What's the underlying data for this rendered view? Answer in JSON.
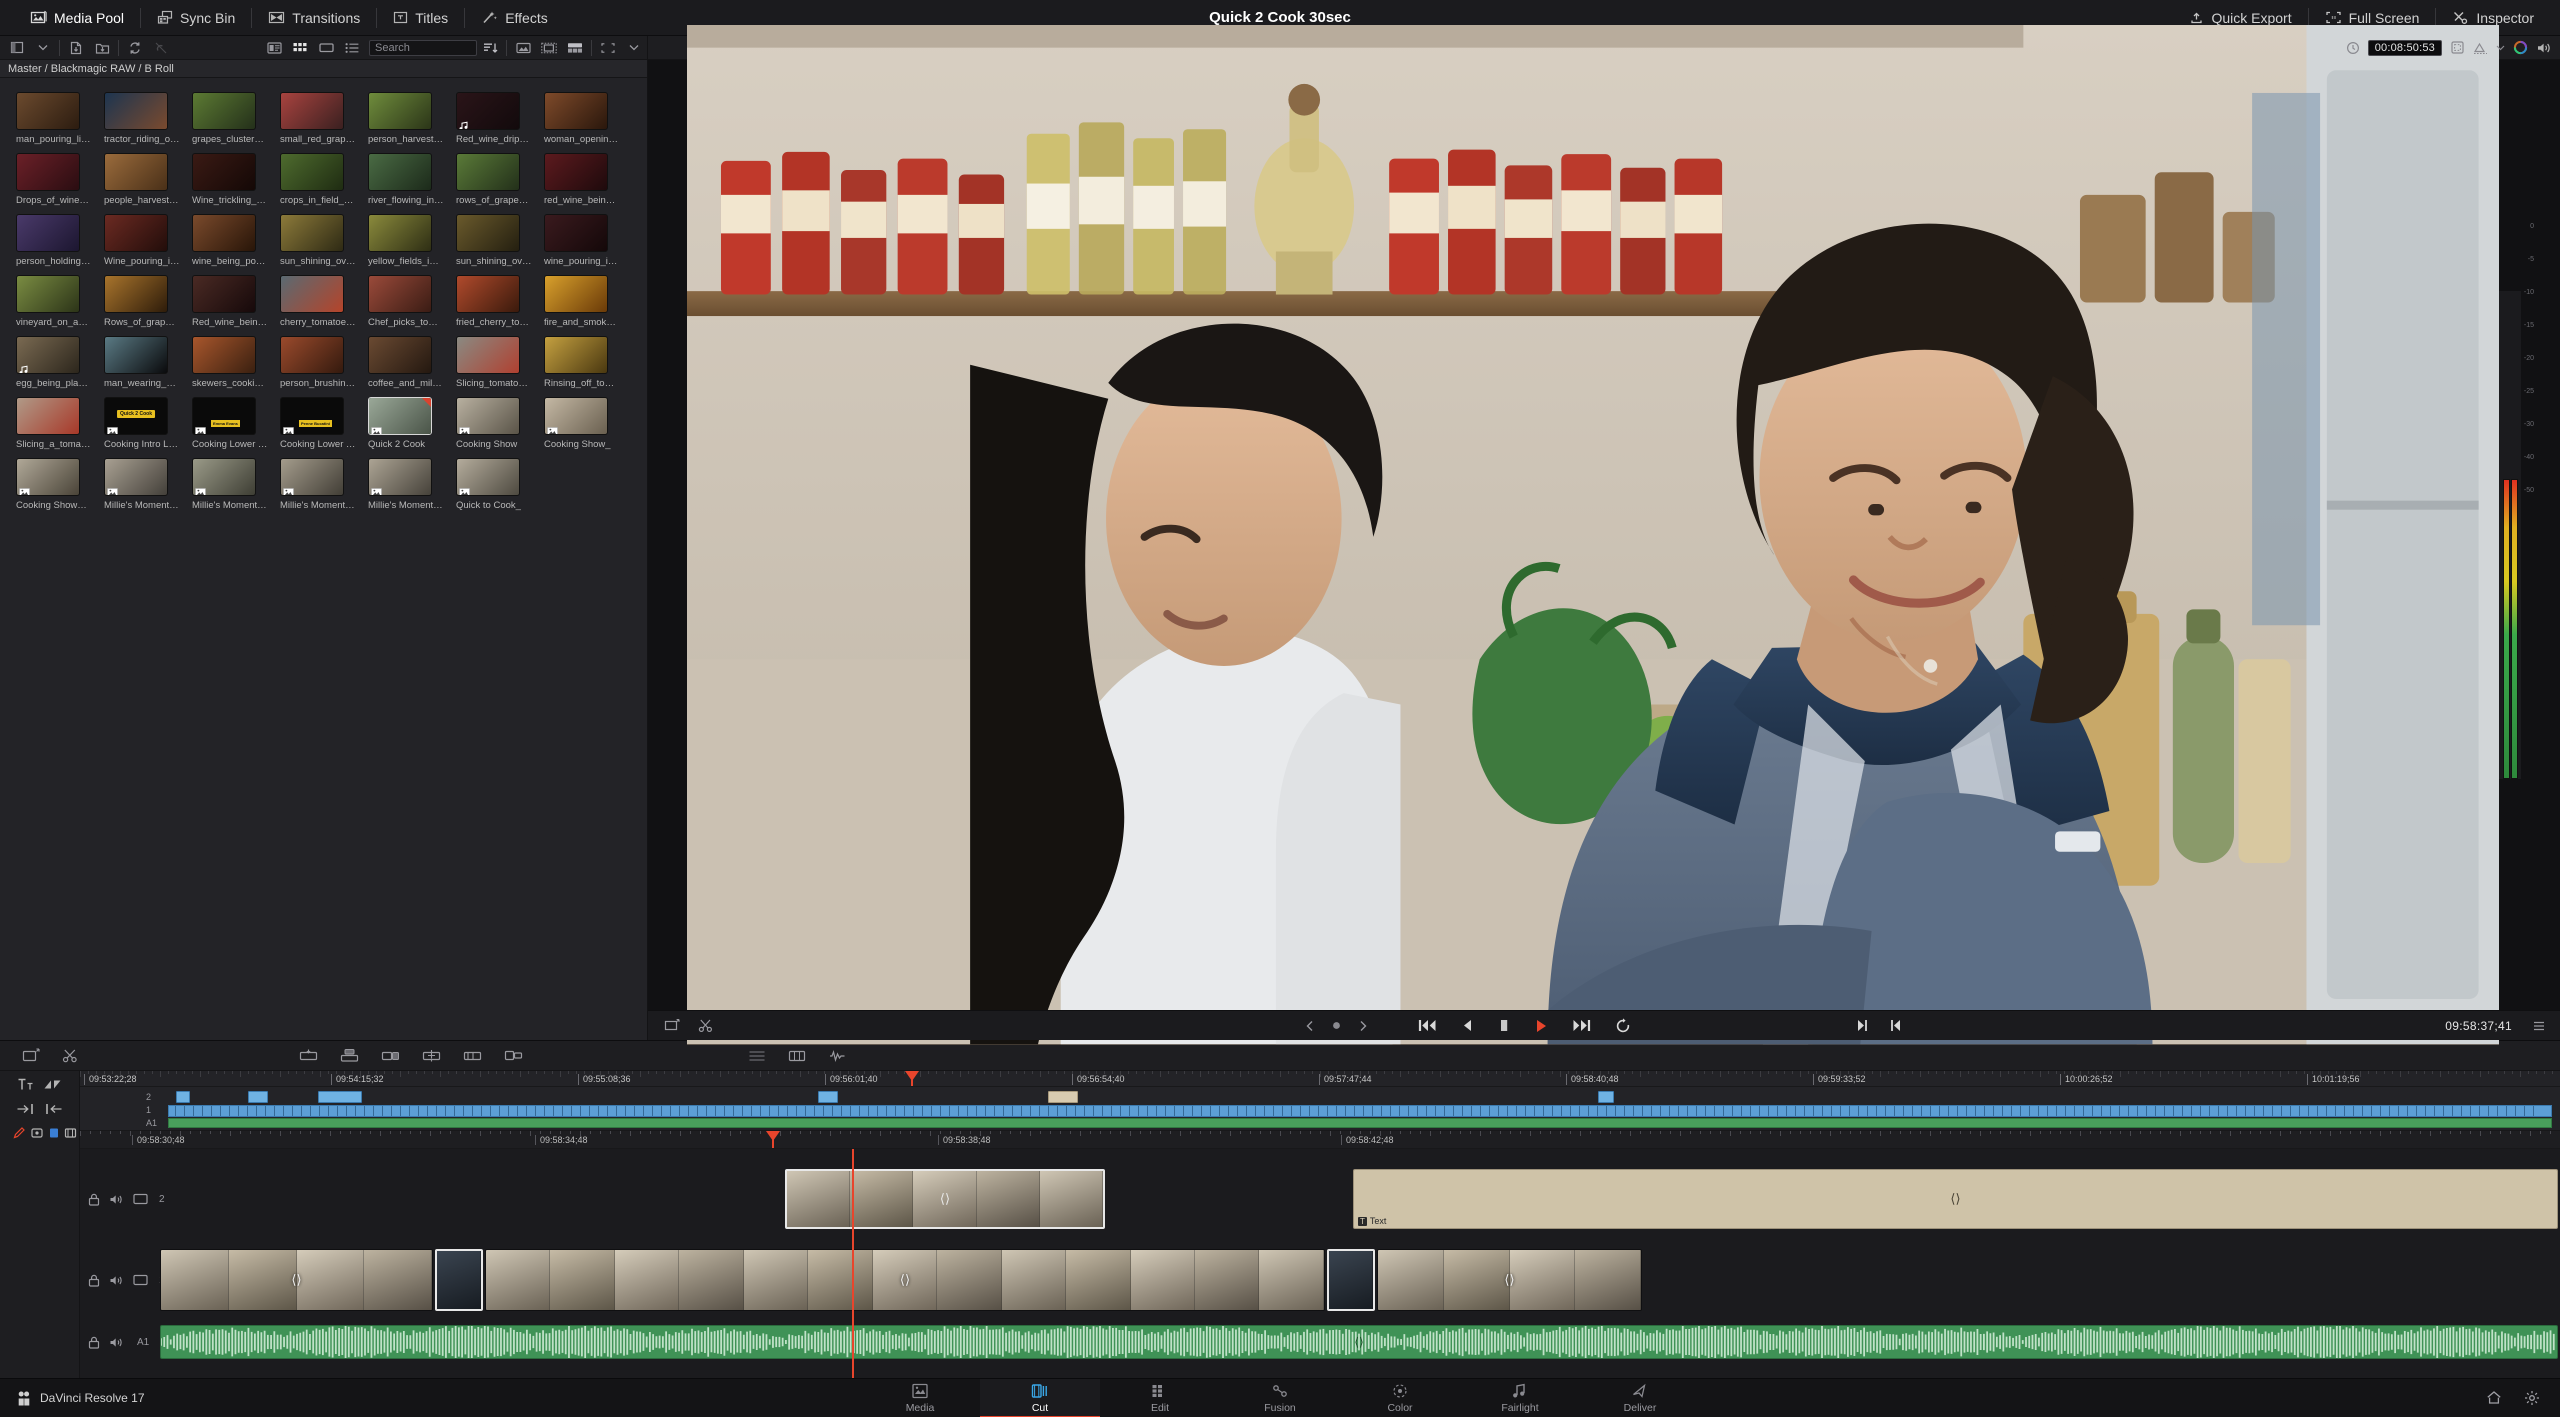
{
  "app": {
    "title": "Quick 2 Cook 30sec",
    "brand": "DaVinci Resolve 17"
  },
  "topbar": {
    "left_items": [
      {
        "label": "Media Pool",
        "icon": "media-pool-icon",
        "active": true
      },
      {
        "label": "Sync Bin",
        "icon": "sync-bin-icon",
        "active": false
      },
      {
        "label": "Transitions",
        "icon": "transitions-icon",
        "active": false
      },
      {
        "label": "Titles",
        "icon": "titles-icon",
        "active": false
      },
      {
        "label": "Effects",
        "icon": "effects-icon",
        "active": false
      }
    ],
    "right_items": [
      {
        "label": "Quick Export",
        "icon": "quick-export-icon"
      },
      {
        "label": "Full Screen",
        "icon": "full-screen-icon"
      },
      {
        "label": "Inspector",
        "icon": "inspector-icon"
      }
    ]
  },
  "mediapool": {
    "breadcrumb": "Master / Blackmagic RAW / B Roll",
    "search": {
      "placeholder": "Search",
      "value": ""
    },
    "toolbar_icons": [
      "sidebar-toggle-icon",
      "chevron-down-icon",
      "import-media-icon",
      "import-bin-icon",
      "sync-icon",
      "unlink-icon"
    ],
    "view_icons": [
      "metadata-view-icon",
      "thumbnail-view-icon",
      "filmstrip-view-icon",
      "list-view-icon",
      "sort-icon",
      "source-tape-icon",
      "full-clip-icon",
      "strip-view-icon",
      "fullscreen-icon",
      "chevron-down-icon"
    ],
    "clips": [
      {
        "label": "man_pouring_liqu...",
        "c1": "#6b4a2e",
        "c2": "#2c1c10",
        "badge": ""
      },
      {
        "label": "tractor_riding_ove...",
        "c1": "#1d3550",
        "c2": "#7a4a2e",
        "badge": ""
      },
      {
        "label": "grapes_cluster_on...",
        "c1": "#5c7a33",
        "c2": "#24301a",
        "badge": ""
      },
      {
        "label": "small_red_grape_c...",
        "c1": "#a8433f",
        "c2": "#3a2020",
        "badge": ""
      },
      {
        "label": "person_harvestin...",
        "c1": "#6f8c3c",
        "c2": "#2b3518",
        "badge": ""
      },
      {
        "label": "Red_wine_drippin...",
        "c1": "#2a1418",
        "c2": "#120a0c",
        "badge": "audio"
      },
      {
        "label": "woman_opening_...",
        "c1": "#7e4a2a",
        "c2": "#2a170c",
        "badge": ""
      },
      {
        "label": "Drops_of_wine_sp...",
        "c1": "#6b2028",
        "c2": "#2a0d11",
        "badge": ""
      },
      {
        "label": "people_harvesting...",
        "c1": "#9a6b3c",
        "c2": "#4a3018",
        "badge": ""
      },
      {
        "label": "Wine_trickling_fro...",
        "c1": "#3a1a14",
        "c2": "#140806",
        "badge": ""
      },
      {
        "label": "crops_in_field_at_...",
        "c1": "#4e6b2e",
        "c2": "#1f2c12",
        "badge": ""
      },
      {
        "label": "river_flowing_in_t...",
        "c1": "#4a6b44",
        "c2": "#1c2a1a",
        "badge": ""
      },
      {
        "label": "rows_of_grapevin...",
        "c1": "#5a7a38",
        "c2": "#23301a",
        "badge": ""
      },
      {
        "label": "red_wine_being_p...",
        "c1": "#5c1a1e",
        "c2": "#1e0a0c",
        "badge": ""
      },
      {
        "label": "person_holding_a...",
        "c1": "#4a3a6a",
        "c2": "#1c1630",
        "badge": ""
      },
      {
        "label": "Wine_pouring_int...",
        "c1": "#6b2a22",
        "c2": "#220d0a",
        "badge": ""
      },
      {
        "label": "wine_being_poure...",
        "c1": "#7a4a2c",
        "c2": "#281508",
        "badge": ""
      },
      {
        "label": "sun_shining_over_...",
        "c1": "#8c7a3a",
        "c2": "#2e2a14",
        "badge": ""
      },
      {
        "label": "yellow_fields_in_bl...",
        "c1": "#8a8a3c",
        "c2": "#2e2e14",
        "badge": ""
      },
      {
        "label": "sun_shining_over_...",
        "c1": "#6a5a2c",
        "c2": "#241f10",
        "badge": ""
      },
      {
        "label": "wine_pouring_into...",
        "c1": "#3a1a1e",
        "c2": "#140809",
        "badge": ""
      },
      {
        "label": "vineyard_on_a_far...",
        "c1": "#7a8c42",
        "c2": "#2c3418",
        "badge": ""
      },
      {
        "label": "Rows_of_grape_tr...",
        "c1": "#a8742c",
        "c2": "#2e1c0a",
        "badge": ""
      },
      {
        "label": "Red_wine_being_p...",
        "c1": "#4a2a24",
        "c2": "#16090a",
        "badge": ""
      },
      {
        "label": "cherry_tomatoes_...",
        "c1": "#5a6a72",
        "c2": "#b5442a",
        "badge": ""
      },
      {
        "label": "Chef_picks_tomat...",
        "c1": "#9a4a3a",
        "c2": "#3a1c14",
        "badge": ""
      },
      {
        "label": "fried_cherry_toma...",
        "c1": "#b04a2c",
        "c2": "#3a1a0c",
        "badge": ""
      },
      {
        "label": "fire_and_smoke_c...",
        "c1": "#d8a02c",
        "c2": "#6a3a08",
        "badge": ""
      },
      {
        "label": "egg_being_placed...",
        "c1": "#7a6a52",
        "c2": "#2c261c",
        "badge": "audio"
      },
      {
        "label": "man_wearing_an_...",
        "c1": "#5a7a84",
        "c2": "#0a0a0c",
        "badge": ""
      },
      {
        "label": "skewers_cooking_...",
        "c1": "#a8562c",
        "c2": "#3a2010",
        "badge": ""
      },
      {
        "label": "person_brushing_...",
        "c1": "#9a4a2c",
        "c2": "#341a0e",
        "badge": ""
      },
      {
        "label": "coffee_and_milk_b...",
        "c1": "#6a4a32",
        "c2": "#241810",
        "badge": ""
      },
      {
        "label": "Slicing_tomatoes_...",
        "c1": "#8a8a82",
        "c2": "#b04030",
        "badge": ""
      },
      {
        "label": "Rinsing_off_tomat...",
        "c1": "#c4a040",
        "c2": "#4a3810",
        "badge": ""
      },
      {
        "label": "Slicing_a_tomato_...",
        "c1": "#b09a88",
        "c2": "#a83828",
        "badge": ""
      },
      {
        "label": "Cooking Intro Log...",
        "c1": "#0a0a0a",
        "c2": "#0a0a0a",
        "badge": "gfx",
        "logo": "Quick 2 Cook"
      },
      {
        "label": "Cooking Lower Thi...",
        "c1": "#0a0a0a",
        "c2": "#0a0a0a",
        "badge": "gfx",
        "lower": "Emma Evans"
      },
      {
        "label": "Cooking Lower Thi...",
        "c1": "#0a0a0a",
        "c2": "#0a0a0a",
        "badge": "gfx",
        "lower": "Penne Bucatini"
      },
      {
        "label": "Quick 2 Cook",
        "c1": "#9aa898",
        "c2": "#4a5448",
        "badge": "gfx",
        "marked": true
      },
      {
        "label": "Cooking Show",
        "c1": "#b8b0a0",
        "c2": "#5a5448",
        "badge": "gfx"
      },
      {
        "label": "Cooking Show_",
        "c1": "#c4b8a4",
        "c2": "#6a6050",
        "badge": "gfx"
      },
      {
        "label": "Cooking Show_tvc",
        "c1": "#b0a898",
        "c2": "#4a4438",
        "badge": "gfx"
      },
      {
        "label": "Millie's Moments ...",
        "c1": "#a8a092",
        "c2": "#44403a",
        "badge": "gfx"
      },
      {
        "label": "Millie's Moments ...",
        "c1": "#9a9a88",
        "c2": "#3e3e34",
        "badge": "gfx"
      },
      {
        "label": "Millie's Moments ...",
        "c1": "#a49c8c",
        "c2": "#423e36",
        "badge": "gfx"
      },
      {
        "label": "Millie's Moments ...",
        "c1": "#aca494",
        "c2": "#46423a",
        "badge": "gfx"
      },
      {
        "label": "Quick to Cook_",
        "c1": "#b4ac9c",
        "c2": "#4e4a40",
        "badge": "gfx"
      }
    ]
  },
  "viewer": {
    "timeline_name": "Quick 2 Cook",
    "timecode": "00:08:50:53",
    "header_icons": [
      "clock-icon",
      "safe-area-icon",
      "chevron-down-icon",
      "color-wheel-icon",
      "audio-icon",
      "more-options-icon"
    ],
    "scope_labels": [
      "0",
      "-5",
      "-10",
      "-15",
      "-20",
      "-25",
      "-30",
      "-40",
      "-50"
    ]
  },
  "transport": {
    "left_icons": [
      "export-still-icon",
      "scissors-icon"
    ],
    "mid_icons": [
      "source-overwrite-icon",
      "place-on-top-icon",
      "append-icon",
      "smart-insert-icon",
      "ripple-overwrite-icon",
      "close-up-icon"
    ],
    "right_icons": [
      "snap-icon",
      "audio-level-icon"
    ],
    "playback": {
      "prev_clip": "skip-back-icon",
      "step_back": "step-back-icon",
      "stop": "stop-icon",
      "play": "play-icon",
      "next_clip": "skip-forward-icon",
      "loop": "loop-icon",
      "in_point": "mark-in-icon",
      "out_point": "mark-out-icon"
    },
    "timecode": "09:58:37;41"
  },
  "timeline": {
    "tool_icons": [
      "text-tool-icon",
      "transition-tool-icon",
      "trim-in-icon",
      "trim-out-icon",
      "pen-tool-icon",
      "sync-bin-icon",
      "marker-icon",
      "flag-icon"
    ],
    "ruler_top": [
      "09:53:22;28",
      "09:54:15;32",
      "09:55:08;36",
      "09:56:01;40",
      "09:56:54;40",
      "09:57:47;44",
      "09:58:40;48",
      "09:59:33;52",
      "10:00:26;52",
      "10:01:19;56"
    ],
    "ruler_bottom": [
      "09:58:30;48",
      "09:58:34;48",
      "09:58:38;48",
      "09:58:42;48"
    ],
    "track_labels": {
      "v2": "2",
      "v1": "1",
      "a1": "A1"
    },
    "text_clip_label": "Text",
    "track_head_icons": [
      "lock-icon",
      "audio-mute-icon",
      "video-toggle-icon"
    ]
  },
  "bottombar": {
    "brand": "DaVinci Resolve 17",
    "pages": [
      {
        "label": "Media",
        "icon": "media-page-icon",
        "active": false
      },
      {
        "label": "Cut",
        "icon": "cut-page-icon",
        "active": true
      },
      {
        "label": "Edit",
        "icon": "edit-page-icon",
        "active": false
      },
      {
        "label": "Fusion",
        "icon": "fusion-page-icon",
        "active": false
      },
      {
        "label": "Color",
        "icon": "color-page-icon",
        "active": false
      },
      {
        "label": "Fairlight",
        "icon": "fairlight-page-icon",
        "active": false
      },
      {
        "label": "Deliver",
        "icon": "deliver-page-icon",
        "active": false
      }
    ],
    "right_icons": [
      "home-icon",
      "settings-icon"
    ]
  },
  "colors": {
    "accent_red": "#e8452c",
    "video_track": "#6fb2e3",
    "audio_track": "#3f9256",
    "text_track": "#cfc3a8",
    "panel_bg": "#1b1b1e"
  }
}
